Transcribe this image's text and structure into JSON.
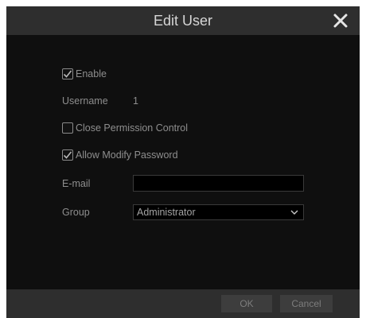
{
  "dialog": {
    "title": "Edit User"
  },
  "form": {
    "enable": {
      "label": "Enable",
      "checked": true
    },
    "username": {
      "label": "Username",
      "value": "1"
    },
    "close_permission": {
      "label": "Close Permission Control",
      "checked": false
    },
    "allow_modify_password": {
      "label": "Allow Modify Password",
      "checked": true
    },
    "email": {
      "label": "E-mail",
      "value": "",
      "placeholder": ""
    },
    "group": {
      "label": "Group",
      "selected": "Administrator"
    }
  },
  "footer": {
    "ok_label": "OK",
    "cancel_label": "Cancel"
  },
  "icons": {
    "close": "close-icon",
    "check": "checkmark-icon",
    "dropdown": "chevron-down-icon"
  },
  "colors": {
    "background": "#0f0f0f",
    "bar": "#2e2e2e",
    "text": "#8e8e8e",
    "title_text": "#d6d6d6"
  }
}
